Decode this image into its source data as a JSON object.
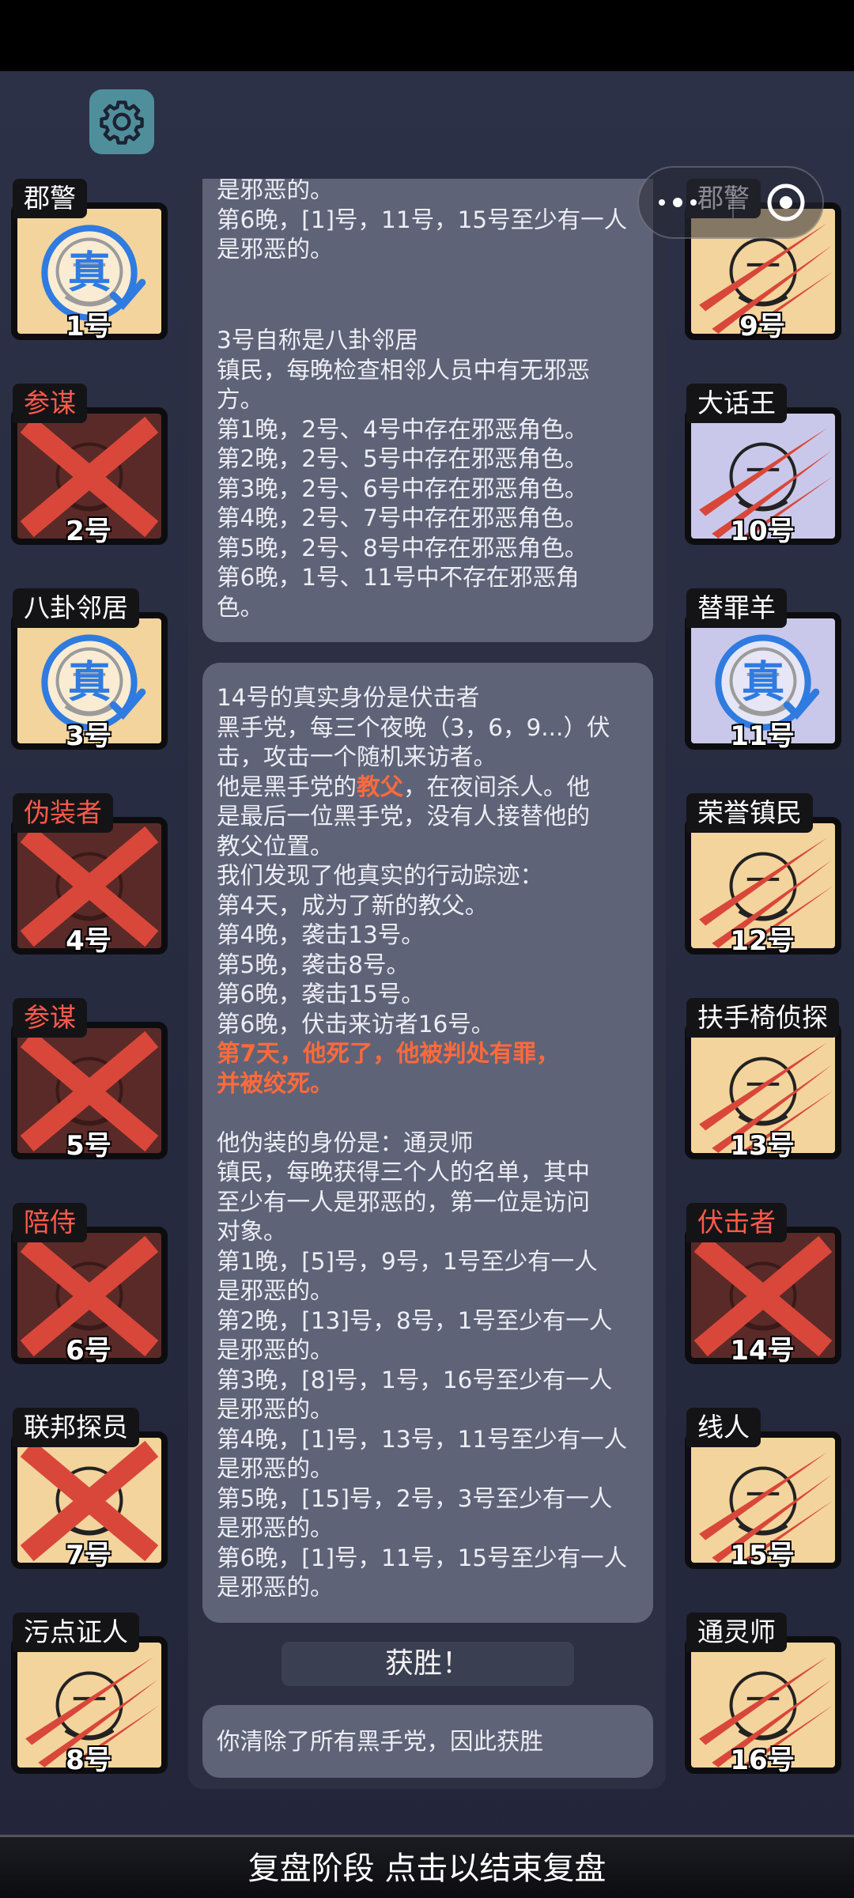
{
  "players_left": [
    {
      "role": "郡警",
      "number": "1号",
      "state": "verified",
      "color": "tan",
      "role_color": "white",
      "badge": "真"
    },
    {
      "role": "参谋",
      "number": "2号",
      "state": "eliminated",
      "color": "dead",
      "role_color": "red"
    },
    {
      "role": "八卦邻居",
      "number": "3号",
      "state": "verified",
      "color": "tan",
      "role_color": "white",
      "badge": "真"
    },
    {
      "role": "伪装者",
      "number": "4号",
      "state": "eliminated",
      "color": "dead",
      "role_color": "red"
    },
    {
      "role": "参谋",
      "number": "5号",
      "state": "eliminated",
      "color": "dead",
      "role_color": "red"
    },
    {
      "role": "陪侍",
      "number": "6号",
      "state": "eliminated",
      "color": "dead",
      "role_color": "red"
    },
    {
      "role": "联邦探员",
      "number": "7号",
      "state": "eliminated",
      "color": "tan",
      "role_color": "white"
    },
    {
      "role": "污点证人",
      "number": "8号",
      "state": "attacked",
      "color": "tan",
      "role_color": "white"
    }
  ],
  "players_right": [
    {
      "role": "郡警",
      "number": "9号",
      "state": "attacked",
      "color": "tan",
      "role_color": "white"
    },
    {
      "role": "大话王",
      "number": "10号",
      "state": "attacked",
      "color": "lav",
      "role_color": "white"
    },
    {
      "role": "替罪羊",
      "number": "11号",
      "state": "verified",
      "color": "lav",
      "role_color": "white",
      "badge": "真"
    },
    {
      "role": "荣誉镇民",
      "number": "12号",
      "state": "attacked",
      "color": "tan",
      "role_color": "white"
    },
    {
      "role": "扶手椅侦探",
      "number": "13号",
      "state": "attacked",
      "color": "tan",
      "role_color": "white"
    },
    {
      "role": "伏击者",
      "number": "14号",
      "state": "eliminated",
      "color": "dead",
      "role_color": "red"
    },
    {
      "role": "线人",
      "number": "15号",
      "state": "attacked",
      "color": "tan",
      "role_color": "white"
    },
    {
      "role": "通灵师",
      "number": "16号",
      "state": "attacked",
      "color": "tan",
      "role_color": "white"
    }
  ],
  "log": {
    "bubble1": {
      "line0": "是邪恶的。",
      "line1": "第6晚，[1]号，11号，15号至少有一人",
      "line2": "是邪恶的。"
    },
    "bubble2": {
      "line0": "3号自称是八卦邻居",
      "line1": "镇民，每晚检查相邻人员中有无邪恶",
      "line2": "方。",
      "line3": "第1晚，2号、4号中存在邪恶角色。",
      "line4": "第2晚，2号、5号中存在邪恶角色。",
      "line5": "第3晚，2号、6号中存在邪恶角色。",
      "line6": "第4晚，2号、7号中存在邪恶角色。",
      "line7": "第5晚，2号、8号中存在邪恶角色。",
      "line8": "第6晚，1号、11号中不存在邪恶角",
      "line9": "色。"
    },
    "bubble3": {
      "line0": "14号的真实身份是伏击者",
      "line1": "黑手党，每三个夜晚（3，6，9...）伏",
      "line2": "击，攻击一个随机来访者。",
      "line3a": "他是黑手党的",
      "line3b": "教父",
      "line3c": "，在夜间杀人。他",
      "line4": "是最后一位黑手党，没有人接替他的",
      "line5": "教父位置。",
      "line6": "我们发现了他真实的行动踪迹：",
      "line7": "第4天，成为了新的教父。",
      "line8": "第4晚，袭击13号。",
      "line9": "第5晚，袭击8号。",
      "line10": "第6晚，袭击15号。",
      "line11": "第6晚，伏击来访者16号。",
      "line12": "第7天，他死了，他被判处有罪，",
      "line13": "并被绞死。",
      "line14": "他伪装的身份是：通灵师",
      "line15": "镇民，每晚获得三个人的名单，其中",
      "line16": "至少有一人是邪恶的，第一位是访问",
      "line17": "对象。",
      "line18": "第1晚，[5]号，9号，1号至少有一人",
      "line19": "是邪恶的。",
      "line20": "第2晚，[13]号，8号，1号至少有一人",
      "line21": "是邪恶的。",
      "line22": "第3晚，[8]号，1号，16号至少有一人",
      "line23": "是邪恶的。",
      "line24": "第4晚，[1]号，13号，11号至少有一人",
      "line25": "是邪恶的。",
      "line26": "第5晚，[15]号，2号，3号至少有一人",
      "line27": "是邪恶的。",
      "line28": "第6晚，[1]号，11号，15号至少有一人",
      "line29": "是邪恶的。"
    },
    "win_label": "获胜！",
    "win_text": "你清除了所有黑手党，因此获胜"
  },
  "bottom_bar": "复盘阶段 点击以结束复盘",
  "icons": {
    "settings": "gear-icon",
    "more": "more-dots-icon",
    "close": "target-circle-icon"
  },
  "colors": {
    "accent_red": "#ff5a4a",
    "highlight": "#ff6a3d",
    "tile_tan": "#f3d49c",
    "tile_lavender": "#c9c8ea",
    "slash_red": "#d9473a",
    "badge_blue": "#2f7be0"
  }
}
